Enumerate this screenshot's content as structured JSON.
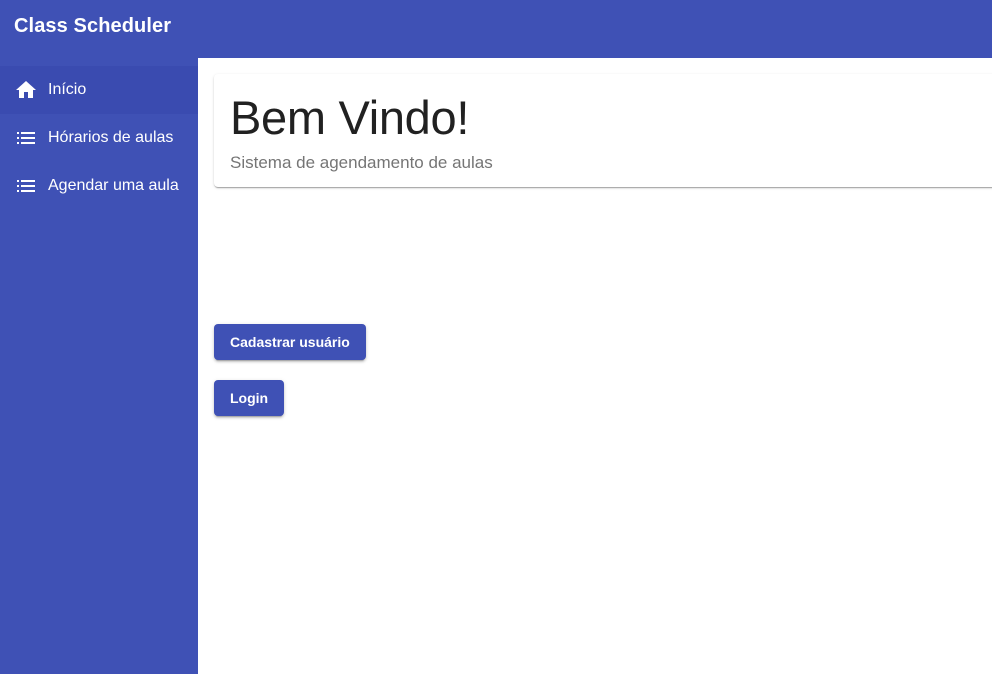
{
  "app": {
    "title": "Class Scheduler"
  },
  "colors": {
    "primary": "#3f51b5",
    "background": "#ffffff"
  },
  "sidebar": {
    "items": [
      {
        "label": "Início",
        "icon": "home-icon",
        "active": true
      },
      {
        "label": "Hórarios de aulas",
        "icon": "list-icon",
        "active": false
      },
      {
        "label": "Agendar uma aula",
        "icon": "list-icon",
        "active": false
      }
    ]
  },
  "hero": {
    "title": "Bem Vindo!",
    "subtitle": "Sistema de agendamento de aulas"
  },
  "actions": {
    "register_label": "Cadastrar usuário",
    "login_label": "Login"
  }
}
